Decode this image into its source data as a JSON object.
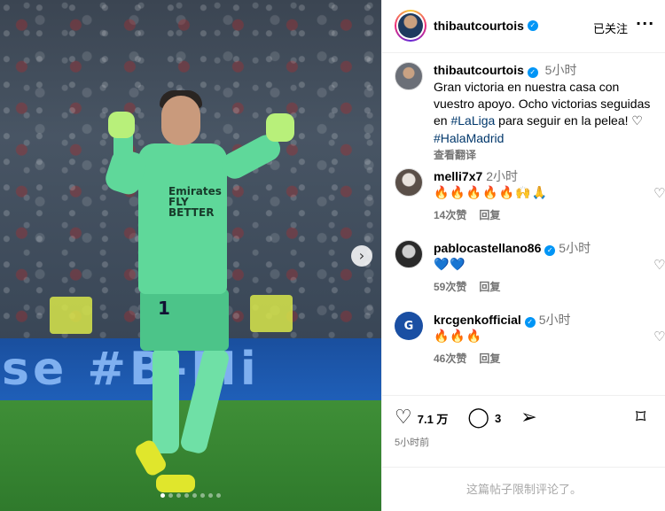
{
  "photo": {
    "banner_text": "se #B-Mi",
    "jersey_number": "1",
    "jersey_sponsor": "Emirates FLY BETTER",
    "carousel_dots": 8,
    "carousel_active_index": 0,
    "next_icon": "chevron-right-icon"
  },
  "header": {
    "username": "thibautcourtois",
    "verified_icon": "verified-badge-icon",
    "follow_status": "已关注",
    "more_icon": "more-horizontal-icon"
  },
  "caption": {
    "username": "thibautcourtois",
    "time": "5小时",
    "text_1": "Gran victoria en nuestra casa con vuestro apoyo. Ocho victorias seguidas en ",
    "tag_laliga": "#LaLiga",
    "text_2": " para seguir en la pelea! ",
    "heart_glyph": "♡",
    "tag_hala": "#HalaMadrid",
    "translate": "查看翻译"
  },
  "comments": [
    {
      "username": "melli7x7",
      "verified": false,
      "time": "2小时",
      "emoji": "🔥🔥🔥🔥🔥🙌🙏",
      "likes": "14次赞",
      "reply": "回复"
    },
    {
      "username": "pablocastellano86",
      "verified": true,
      "time": "5小时",
      "emoji": "💙💙",
      "likes": "59次赞",
      "reply": "回复"
    },
    {
      "username": "krcgenkofficial",
      "verified": true,
      "time": "5小时",
      "emoji": "🔥🔥🔥",
      "likes": "46次赞",
      "reply": "回复"
    }
  ],
  "actions": {
    "like_icon": "heart-icon",
    "like_count": "7.1 万",
    "comment_icon": "comment-icon",
    "comment_count": "3",
    "share_icon": "share-icon",
    "save_icon": "bookmark-icon",
    "posted_time": "5小时前"
  },
  "footer": {
    "notice": "这篇帖子限制评论了。"
  },
  "colors": {
    "link": "#00376b",
    "verified": "#0095f6",
    "muted": "#737373"
  }
}
